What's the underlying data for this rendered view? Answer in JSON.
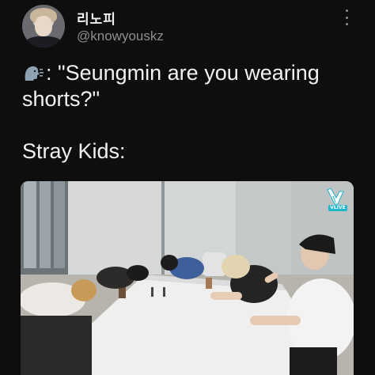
{
  "author": {
    "display_name": "리노피",
    "handle": "@knowyouskz"
  },
  "tweet": {
    "speaker_icon": "speaking-head-icon",
    "line1_after_icon": ": \"Seungmin are you wearing",
    "line2": "shorts?\"",
    "line3": "Stray Kids:"
  },
  "media": {
    "description_icon": "photo",
    "watermark_logo": "vlive-logo",
    "watermark_text": "VLIVE"
  },
  "colors": {
    "background": "#0e0e0e",
    "text": "#f2f2f2",
    "secondary_text": "#8e8e8e",
    "vlive_accent": "#1fb6c9"
  }
}
